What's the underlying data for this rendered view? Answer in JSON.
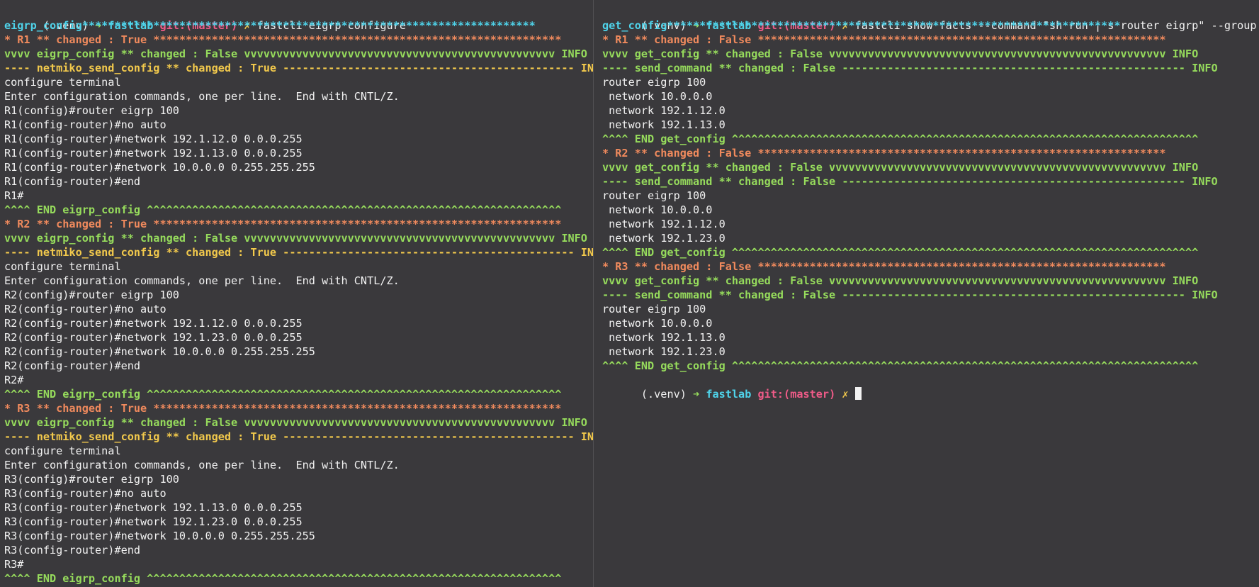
{
  "colors": {
    "background": "#3a393c",
    "text": "#f2f2f2",
    "cyan": "#4fd3ea",
    "green": "#96db5c",
    "yellow": "#f2c94c",
    "orange": "#f08a5d",
    "pink": "#ef5b88"
  },
  "left_pane": {
    "prompt": {
      "venv": "(.venv) ",
      "arrow": "➜ ",
      "dir": "fastlab ",
      "git": "git:(master) ",
      "dirty": "✗ ",
      "command": "fastcli eigrp configure"
    },
    "lines": [
      {
        "color": "cyan",
        "text": "eigrp_config**********************************************************************"
      },
      {
        "color": "orange",
        "text": "* R1 ** changed : True ***************************************************************"
      },
      {
        "color": "green",
        "text": "vvvv eigrp_config ** changed : False vvvvvvvvvvvvvvvvvvvvvvvvvvvvvvvvvvvvvvvvvvvvvvvv INFO"
      },
      {
        "color": "yellow",
        "text": "---- netmiko_send_config ** changed : True --------------------------------------------- INFO"
      },
      {
        "color": "white",
        "text": "configure terminal"
      },
      {
        "color": "white",
        "text": "Enter configuration commands, one per line.  End with CNTL/Z."
      },
      {
        "color": "white",
        "text": "R1(config)#router eigrp 100"
      },
      {
        "color": "white",
        "text": "R1(config-router)#no auto"
      },
      {
        "color": "white",
        "text": "R1(config-router)#network 192.1.12.0 0.0.0.255"
      },
      {
        "color": "white",
        "text": "R1(config-router)#network 192.1.13.0 0.0.0.255"
      },
      {
        "color": "white",
        "text": "R1(config-router)#network 10.0.0.0 0.255.255.255"
      },
      {
        "color": "white",
        "text": "R1(config-router)#end"
      },
      {
        "color": "white",
        "text": "R1#"
      },
      {
        "color": "green",
        "text": "^^^^ END eigrp_config ^^^^^^^^^^^^^^^^^^^^^^^^^^^^^^^^^^^^^^^^^^^^^^^^^^^^^^^^^^^^^^^^"
      },
      {
        "color": "orange",
        "text": "* R2 ** changed : True ***************************************************************"
      },
      {
        "color": "green",
        "text": "vvvv eigrp_config ** changed : False vvvvvvvvvvvvvvvvvvvvvvvvvvvvvvvvvvvvvvvvvvvvvvvv INFO"
      },
      {
        "color": "yellow",
        "text": "---- netmiko_send_config ** changed : True --------------------------------------------- INFO"
      },
      {
        "color": "white",
        "text": "configure terminal"
      },
      {
        "color": "white",
        "text": "Enter configuration commands, one per line.  End with CNTL/Z."
      },
      {
        "color": "white",
        "text": "R2(config)#router eigrp 100"
      },
      {
        "color": "white",
        "text": "R2(config-router)#no auto"
      },
      {
        "color": "white",
        "text": "R2(config-router)#network 192.1.12.0 0.0.0.255"
      },
      {
        "color": "white",
        "text": "R2(config-router)#network 192.1.23.0 0.0.0.255"
      },
      {
        "color": "white",
        "text": "R2(config-router)#network 10.0.0.0 0.255.255.255"
      },
      {
        "color": "white",
        "text": "R2(config-router)#end"
      },
      {
        "color": "white",
        "text": "R2#"
      },
      {
        "color": "green",
        "text": "^^^^ END eigrp_config ^^^^^^^^^^^^^^^^^^^^^^^^^^^^^^^^^^^^^^^^^^^^^^^^^^^^^^^^^^^^^^^^"
      },
      {
        "color": "orange",
        "text": "* R3 ** changed : True ***************************************************************"
      },
      {
        "color": "green",
        "text": "vvvv eigrp_config ** changed : False vvvvvvvvvvvvvvvvvvvvvvvvvvvvvvvvvvvvvvvvvvvvvvvv INFO"
      },
      {
        "color": "yellow",
        "text": "---- netmiko_send_config ** changed : True --------------------------------------------- INFO"
      },
      {
        "color": "white",
        "text": "configure terminal"
      },
      {
        "color": "white",
        "text": "Enter configuration commands, one per line.  End with CNTL/Z."
      },
      {
        "color": "white",
        "text": "R3(config)#router eigrp 100"
      },
      {
        "color": "white",
        "text": "R3(config-router)#no auto"
      },
      {
        "color": "white",
        "text": "R3(config-router)#network 192.1.13.0 0.0.0.255"
      },
      {
        "color": "white",
        "text": "R3(config-router)#network 192.1.23.0 0.0.0.255"
      },
      {
        "color": "white",
        "text": "R3(config-router)#network 10.0.0.0 0.255.255.255"
      },
      {
        "color": "white",
        "text": "R3(config-router)#end"
      },
      {
        "color": "white",
        "text": "R3#"
      },
      {
        "color": "green",
        "text": "^^^^ END eigrp_config ^^^^^^^^^^^^^^^^^^^^^^^^^^^^^^^^^^^^^^^^^^^^^^^^^^^^^^^^^^^^^^^^"
      }
    ]
  },
  "right_pane": {
    "prompt": {
      "venv": "(.venv) ",
      "arrow": "➜ ",
      "dir": "fastlab ",
      "git": "git:(master) ",
      "dirty": "✗ ",
      "command": "fastcli show facts --command \"sh run | s router eigrp\" --group eigrp"
    },
    "lines": [
      {
        "color": "cyan",
        "text": "get_config**********************************************************************"
      },
      {
        "color": "orange",
        "text": "* R1 ** changed : False ***************************************************************"
      },
      {
        "color": "green",
        "text": "vvvv get_config ** changed : False vvvvvvvvvvvvvvvvvvvvvvvvvvvvvvvvvvvvvvvvvvvvvvvvvvvv INFO"
      },
      {
        "color": "green",
        "text": "---- send_command ** changed : False ----------------------------------------------------- INFO"
      },
      {
        "color": "white",
        "text": "router eigrp 100"
      },
      {
        "color": "white",
        "text": " network 10.0.0.0"
      },
      {
        "color": "white",
        "text": " network 192.1.12.0"
      },
      {
        "color": "white",
        "text": " network 192.1.13.0"
      },
      {
        "color": "green",
        "text": "^^^^ END get_config ^^^^^^^^^^^^^^^^^^^^^^^^^^^^^^^^^^^^^^^^^^^^^^^^^^^^^^^^^^^^^^^^^^^^^^^^"
      },
      {
        "color": "orange",
        "text": "* R2 ** changed : False ***************************************************************"
      },
      {
        "color": "green",
        "text": "vvvv get_config ** changed : False vvvvvvvvvvvvvvvvvvvvvvvvvvvvvvvvvvvvvvvvvvvvvvvvvvvv INFO"
      },
      {
        "color": "green",
        "text": "---- send_command ** changed : False ----------------------------------------------------- INFO"
      },
      {
        "color": "white",
        "text": "router eigrp 100"
      },
      {
        "color": "white",
        "text": " network 10.0.0.0"
      },
      {
        "color": "white",
        "text": " network 192.1.12.0"
      },
      {
        "color": "white",
        "text": " network 192.1.23.0"
      },
      {
        "color": "green",
        "text": "^^^^ END get_config ^^^^^^^^^^^^^^^^^^^^^^^^^^^^^^^^^^^^^^^^^^^^^^^^^^^^^^^^^^^^^^^^^^^^^^^^"
      },
      {
        "color": "orange",
        "text": "* R3 ** changed : False ***************************************************************"
      },
      {
        "color": "green",
        "text": "vvvv get_config ** changed : False vvvvvvvvvvvvvvvvvvvvvvvvvvvvvvvvvvvvvvvvvvvvvvvvvvvv INFO"
      },
      {
        "color": "green",
        "text": "---- send_command ** changed : False ----------------------------------------------------- INFO"
      },
      {
        "color": "white",
        "text": "router eigrp 100"
      },
      {
        "color": "white",
        "text": " network 10.0.0.0"
      },
      {
        "color": "white",
        "text": " network 192.1.13.0"
      },
      {
        "color": "white",
        "text": " network 192.1.23.0"
      },
      {
        "color": "green",
        "text": "^^^^ END get_config ^^^^^^^^^^^^^^^^^^^^^^^^^^^^^^^^^^^^^^^^^^^^^^^^^^^^^^^^^^^^^^^^^^^^^^^^"
      }
    ],
    "final_prompt": {
      "venv": "(.venv) ",
      "arrow": "➜ ",
      "dir": "fastlab ",
      "git": "git:(master) ",
      "dirty": "✗ "
    }
  }
}
